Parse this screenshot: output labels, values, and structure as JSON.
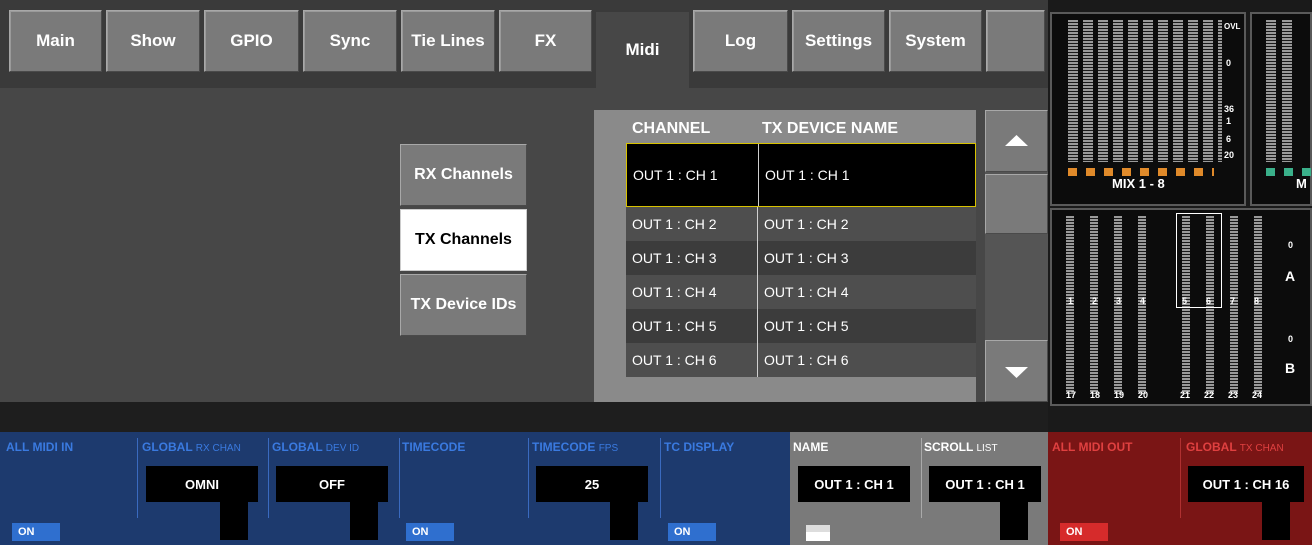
{
  "tabs": [
    {
      "label": "Main"
    },
    {
      "label": "Show"
    },
    {
      "label": "GPIO"
    },
    {
      "label": "Sync"
    },
    {
      "label": "Tie Lines"
    },
    {
      "label": "FX"
    },
    {
      "label": "Midi"
    },
    {
      "label": "Log"
    },
    {
      "label": "Settings"
    },
    {
      "label": "System"
    }
  ],
  "side_buttons": {
    "rx": "RX Channels",
    "tx": "TX Channels",
    "txdev": "TX Device IDs"
  },
  "table": {
    "headers": [
      "CHANNEL",
      "TX DEVICE NAME"
    ],
    "rows": [
      [
        "OUT 1 : CH 1",
        "OUT 1 : CH 1"
      ],
      [
        "OUT 1 : CH 2",
        "OUT 1 : CH 2"
      ],
      [
        "OUT 1 : CH 3",
        "OUT 1 : CH 3"
      ],
      [
        "OUT 1 : CH 4",
        "OUT 1 : CH 4"
      ],
      [
        "OUT 1 : CH 5",
        "OUT 1 : CH 5"
      ],
      [
        "OUT 1 : CH 6",
        "OUT 1 : CH 6"
      ]
    ]
  },
  "meters": {
    "top_labels": {
      "ovl": "OVL",
      "zero": "0",
      "m36": "36",
      "one": "1",
      "six": "6",
      "twenty": "20"
    },
    "mix_label": "MIX 1 - 8",
    "mix_label_2": "M",
    "bank_a": "A",
    "bank_b": "B",
    "zero_a": "0",
    "zero_b": "0",
    "row_a_nums": [
      "1",
      "2",
      "3",
      "4",
      "5",
      "6",
      "7",
      "8"
    ],
    "row_b_nums": [
      "17",
      "18",
      "19",
      "20",
      "21",
      "22",
      "23",
      "24"
    ]
  },
  "bottom": {
    "all_midi_in": "ALL MIDI IN",
    "global_rx_a": "GLOBAL",
    "global_rx_b": "RX CHAN",
    "global_rx_val": "OMNI",
    "global_dev_a": "GLOBAL",
    "global_dev_b": "DEV ID",
    "global_dev_val": "OFF",
    "timecode": "TIMECODE",
    "tc_fps_a": "TIMECODE",
    "tc_fps_b": "FPS",
    "tc_fps_val": "25",
    "tc_display": "TC DISPLAY",
    "name": "NAME",
    "name_val": "OUT 1 : CH 1",
    "scroll_a": "SCROLL",
    "scroll_b": "LIST",
    "scroll_val": "OUT 1 : CH 1",
    "all_midi_out": "ALL MIDI OUT",
    "global_tx_a": "GLOBAL",
    "global_tx_b": "TX CHAN",
    "global_tx_val": "OUT 1 : CH 16",
    "on": "ON"
  },
  "colors": {
    "blue_panel": "#1d3a6e",
    "red_panel": "#7a1515",
    "grey_panel": "#7a7a7a",
    "on_blue": "#2f6fcf",
    "on_red": "#d62b2b",
    "select_border": "#d8c200"
  }
}
